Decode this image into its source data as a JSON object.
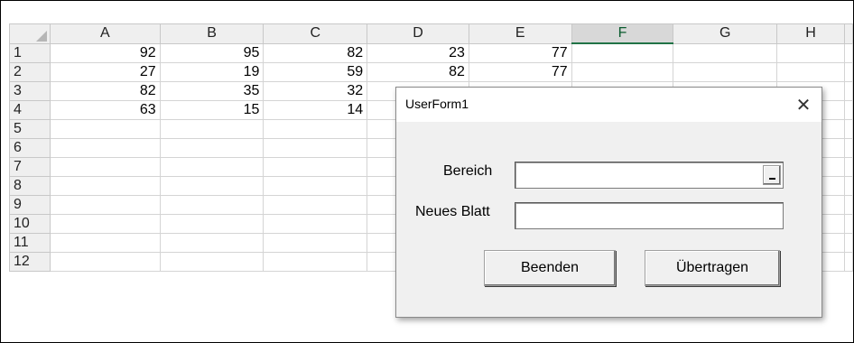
{
  "spreadsheet": {
    "columns": [
      "A",
      "B",
      "C",
      "D",
      "E",
      "F",
      "G",
      "H"
    ],
    "selected_column": "F",
    "rows": [
      {
        "num": "1",
        "cells": [
          "92",
          "95",
          "82",
          "23",
          "77",
          "",
          "",
          ""
        ]
      },
      {
        "num": "2",
        "cells": [
          "27",
          "19",
          "59",
          "82",
          "77",
          "",
          "",
          ""
        ]
      },
      {
        "num": "3",
        "cells": [
          "82",
          "35",
          "32",
          "",
          "",
          "",
          "",
          ""
        ]
      },
      {
        "num": "4",
        "cells": [
          "63",
          "15",
          "14",
          "",
          "",
          "",
          "",
          ""
        ]
      },
      {
        "num": "5",
        "cells": [
          "",
          "",
          "",
          "",
          "",
          "",
          "",
          ""
        ]
      },
      {
        "num": "6",
        "cells": [
          "",
          "",
          "",
          "",
          "",
          "",
          "",
          ""
        ]
      },
      {
        "num": "7",
        "cells": [
          "",
          "",
          "",
          "",
          "",
          "",
          "",
          ""
        ]
      },
      {
        "num": "8",
        "cells": [
          "",
          "",
          "",
          "",
          "",
          "",
          "",
          ""
        ]
      },
      {
        "num": "9",
        "cells": [
          "",
          "",
          "",
          "",
          "",
          "",
          "",
          ""
        ]
      },
      {
        "num": "10",
        "cells": [
          "",
          "",
          "",
          "",
          "",
          "",
          "",
          ""
        ]
      },
      {
        "num": "11",
        "cells": [
          "",
          "",
          "",
          "",
          "",
          "",
          "",
          ""
        ]
      },
      {
        "num": "12",
        "cells": [
          "",
          "",
          "",
          "",
          "",
          "",
          "",
          ""
        ]
      }
    ]
  },
  "userform": {
    "title": "UserForm1",
    "close_glyph": "✕",
    "bereich_label": "Bereich",
    "bereich_value": "",
    "neues_blatt_label": "Neues Blatt",
    "neues_blatt_value": "",
    "beenden_label": "Beenden",
    "uebertragen_label": "Übertragen"
  }
}
